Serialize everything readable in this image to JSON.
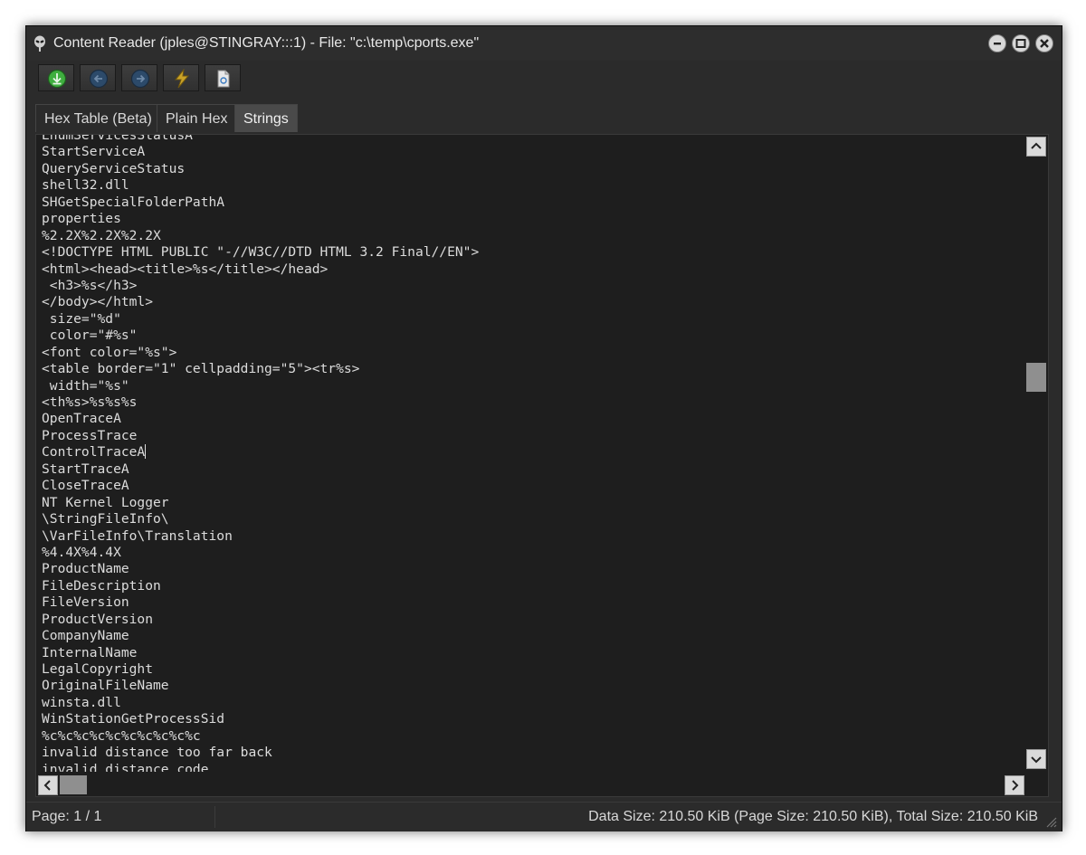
{
  "window": {
    "title": "Content Reader (jples@STINGRAY:::1) - File: \"c:\\temp\\cports.exe\""
  },
  "toolbar": {
    "buttons": [
      "download-icon",
      "back-arrow-icon",
      "forward-arrow-icon",
      "lightning-icon",
      "document-icon"
    ]
  },
  "tabs": [
    {
      "label": "Hex Table (Beta)",
      "active": false
    },
    {
      "label": "Plain Hex",
      "active": false
    },
    {
      "label": "Strings",
      "active": true
    }
  ],
  "strings": {
    "lines": [
      "EnumServicesStatusA",
      "StartServiceA",
      "QueryServiceStatus",
      "shell32.dll",
      "SHGetSpecialFolderPathA",
      "properties",
      "%2.2X%2.2X%2.2X",
      "<!DOCTYPE HTML PUBLIC \"-//W3C//DTD HTML 3.2 Final//EN\">",
      "<html><head><title>%s</title></head>",
      " <h3>%s</h3>",
      "</body></html>",
      " size=\"%d\"",
      " color=\"#%s\"",
      "<font color=\"%s\">",
      "<table border=\"1\" cellpadding=\"5\"><tr%s>",
      " width=\"%s\"",
      "<th%s>%s%s%s",
      "OpenTraceA",
      "ProcessTrace",
      "ControlTraceA",
      "StartTraceA",
      "CloseTraceA",
      "NT Kernel Logger",
      "\\StringFileInfo\\",
      "\\VarFileInfo\\Translation",
      "%4.4X%4.4X",
      "ProductName",
      "FileDescription",
      "FileVersion",
      "ProductVersion",
      "CompanyName",
      "InternalName",
      "LegalCopyright",
      "OriginalFileName",
      "winsta.dll",
      "WinStationGetProcessSid",
      "%c%c%c%c%c%c%c%c%c%c",
      "invalid distance too far back",
      "invalid distance code"
    ]
  },
  "status": {
    "page": "Page: 1 / 1",
    "size": "Data Size: 210.50 KiB (Page Size: 210.50 KiB), Total Size: 210.50 KiB"
  },
  "colors": {
    "background": "#2b2b2b",
    "content_background": "#1e1e1e",
    "text": "#dcdcdc",
    "download_icon": "#3fae3f",
    "lightning_icon": "#c9a227"
  }
}
